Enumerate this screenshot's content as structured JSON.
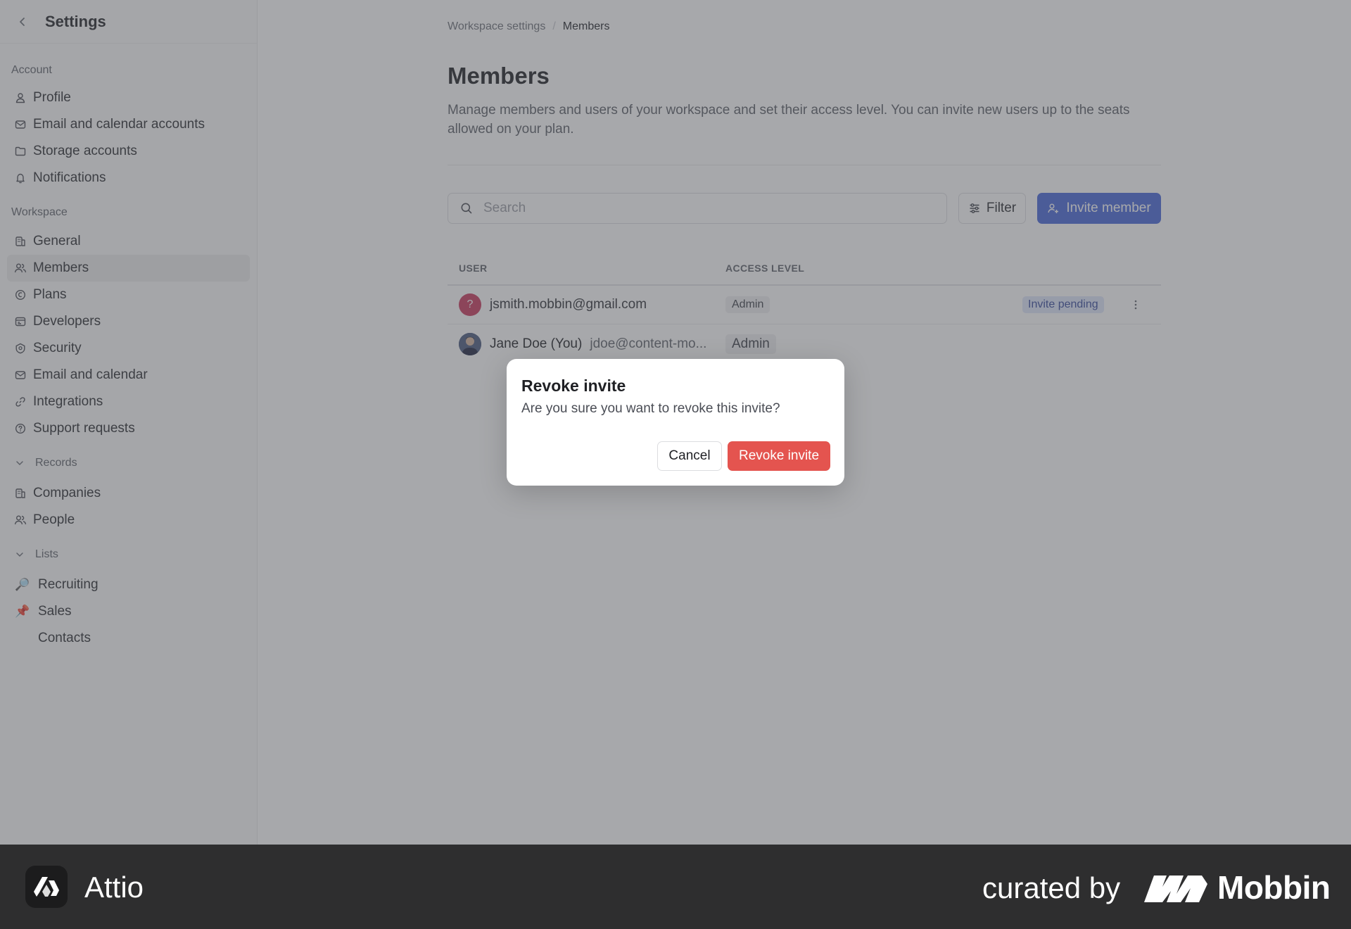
{
  "sidebar": {
    "title": "Settings",
    "account_section": "Account",
    "account_items": [
      {
        "label": "Profile",
        "icon": "user-icon"
      },
      {
        "label": "Email and calendar accounts",
        "icon": "mail-icon"
      },
      {
        "label": "Storage accounts",
        "icon": "folder-icon"
      },
      {
        "label": "Notifications",
        "icon": "bell-icon"
      }
    ],
    "workspace_section": "Workspace",
    "workspace_items": [
      {
        "label": "General",
        "icon": "building-icon"
      },
      {
        "label": "Members",
        "icon": "users-icon",
        "active": true
      },
      {
        "label": "Plans",
        "icon": "plans-icon"
      },
      {
        "label": "Developers",
        "icon": "terminal-icon"
      },
      {
        "label": "Security",
        "icon": "shield-icon"
      },
      {
        "label": "Email and calendar",
        "icon": "mail-icon"
      },
      {
        "label": "Integrations",
        "icon": "link-icon"
      },
      {
        "label": "Support requests",
        "icon": "help-circle-icon"
      }
    ],
    "records_section": "Records",
    "records_items": [
      {
        "label": "Companies",
        "icon": "building-icon"
      },
      {
        "label": "People",
        "icon": "users-icon"
      }
    ],
    "lists_section": "Lists",
    "lists_items": [
      {
        "label": "Recruiting",
        "icon": "magnifier-emoji",
        "glyph": "🔎"
      },
      {
        "label": "Sales",
        "icon": "pushpin-emoji",
        "glyph": "📌"
      },
      {
        "label": "Contacts",
        "icon": "blank-emoji",
        "glyph": ""
      }
    ]
  },
  "breadcrumb": {
    "root": "Workspace settings",
    "separator": "/",
    "current": "Members"
  },
  "page": {
    "title": "Members",
    "description": "Manage members and users of your workspace and set their access level. You can invite new users up to the seats allowed on your plan."
  },
  "toolbar": {
    "search_placeholder": "Search",
    "filter_label": "Filter",
    "invite_label": "Invite member"
  },
  "table": {
    "col_user": "USER",
    "col_access": "ACCESS LEVEL",
    "rows": [
      {
        "avatar_text": "?",
        "email": "jsmith.mobbin@gmail.com",
        "access": "Admin",
        "status": "Invite pending"
      },
      {
        "name": "Jane Doe (You)",
        "email": "jdoe@content-mo...",
        "access": "Admin"
      }
    ]
  },
  "dialog": {
    "title": "Revoke invite",
    "message": "Are you sure you want to revoke this invite?",
    "cancel_label": "Cancel",
    "confirm_label": "Revoke invite"
  },
  "footer": {
    "app_name": "Attio",
    "curated_by": "curated by",
    "brand": "Mobbin"
  },
  "colors": {
    "accent": "#4767d9",
    "danger": "#e4544f",
    "pending_bg": "#dfe6fb",
    "avatar_question": "#c8395d",
    "footer_bg": "#2e2e2f"
  }
}
